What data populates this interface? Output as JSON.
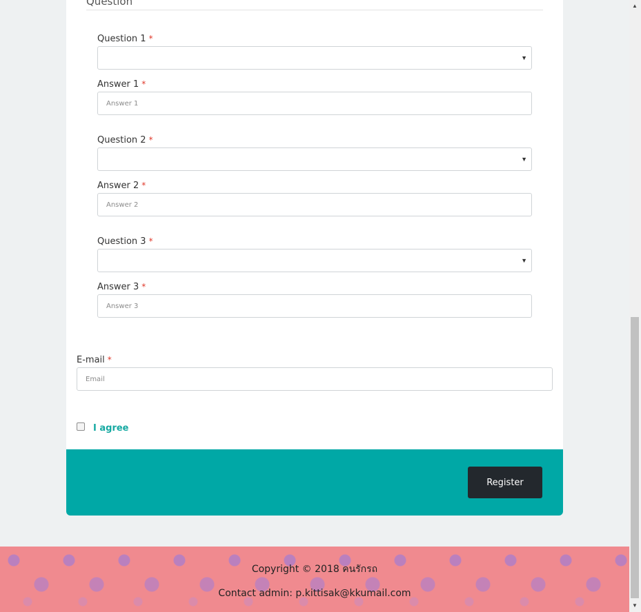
{
  "form": {
    "section_title": "Question",
    "questions": [
      {
        "label": "Question 1",
        "answer_label": "Answer 1",
        "answer_placeholder": "Answer 1"
      },
      {
        "label": "Question 2",
        "answer_label": "Answer 2",
        "answer_placeholder": "Answer 2"
      },
      {
        "label": "Question 3",
        "answer_label": "Answer 3",
        "answer_placeholder": "Answer 3"
      }
    ],
    "required_mark": "*",
    "email_label": "E-mail",
    "email_placeholder": "Email",
    "agree_label": "I agree",
    "register_label": "Register"
  },
  "footer": {
    "copyright": "Copyright © 2018 คนรักรถ",
    "contact": "Contact admin: p.kittisak@kkumail.com"
  },
  "icons": {
    "select_arrow": "caret-down-icon",
    "scroll_up": "scroll-up-icon",
    "scroll_down": "scroll-down-icon"
  },
  "colors": {
    "accent": "#00a8a6",
    "button": "#23282d",
    "required": "#e0392b",
    "footer_bg": "#f08a8f"
  }
}
